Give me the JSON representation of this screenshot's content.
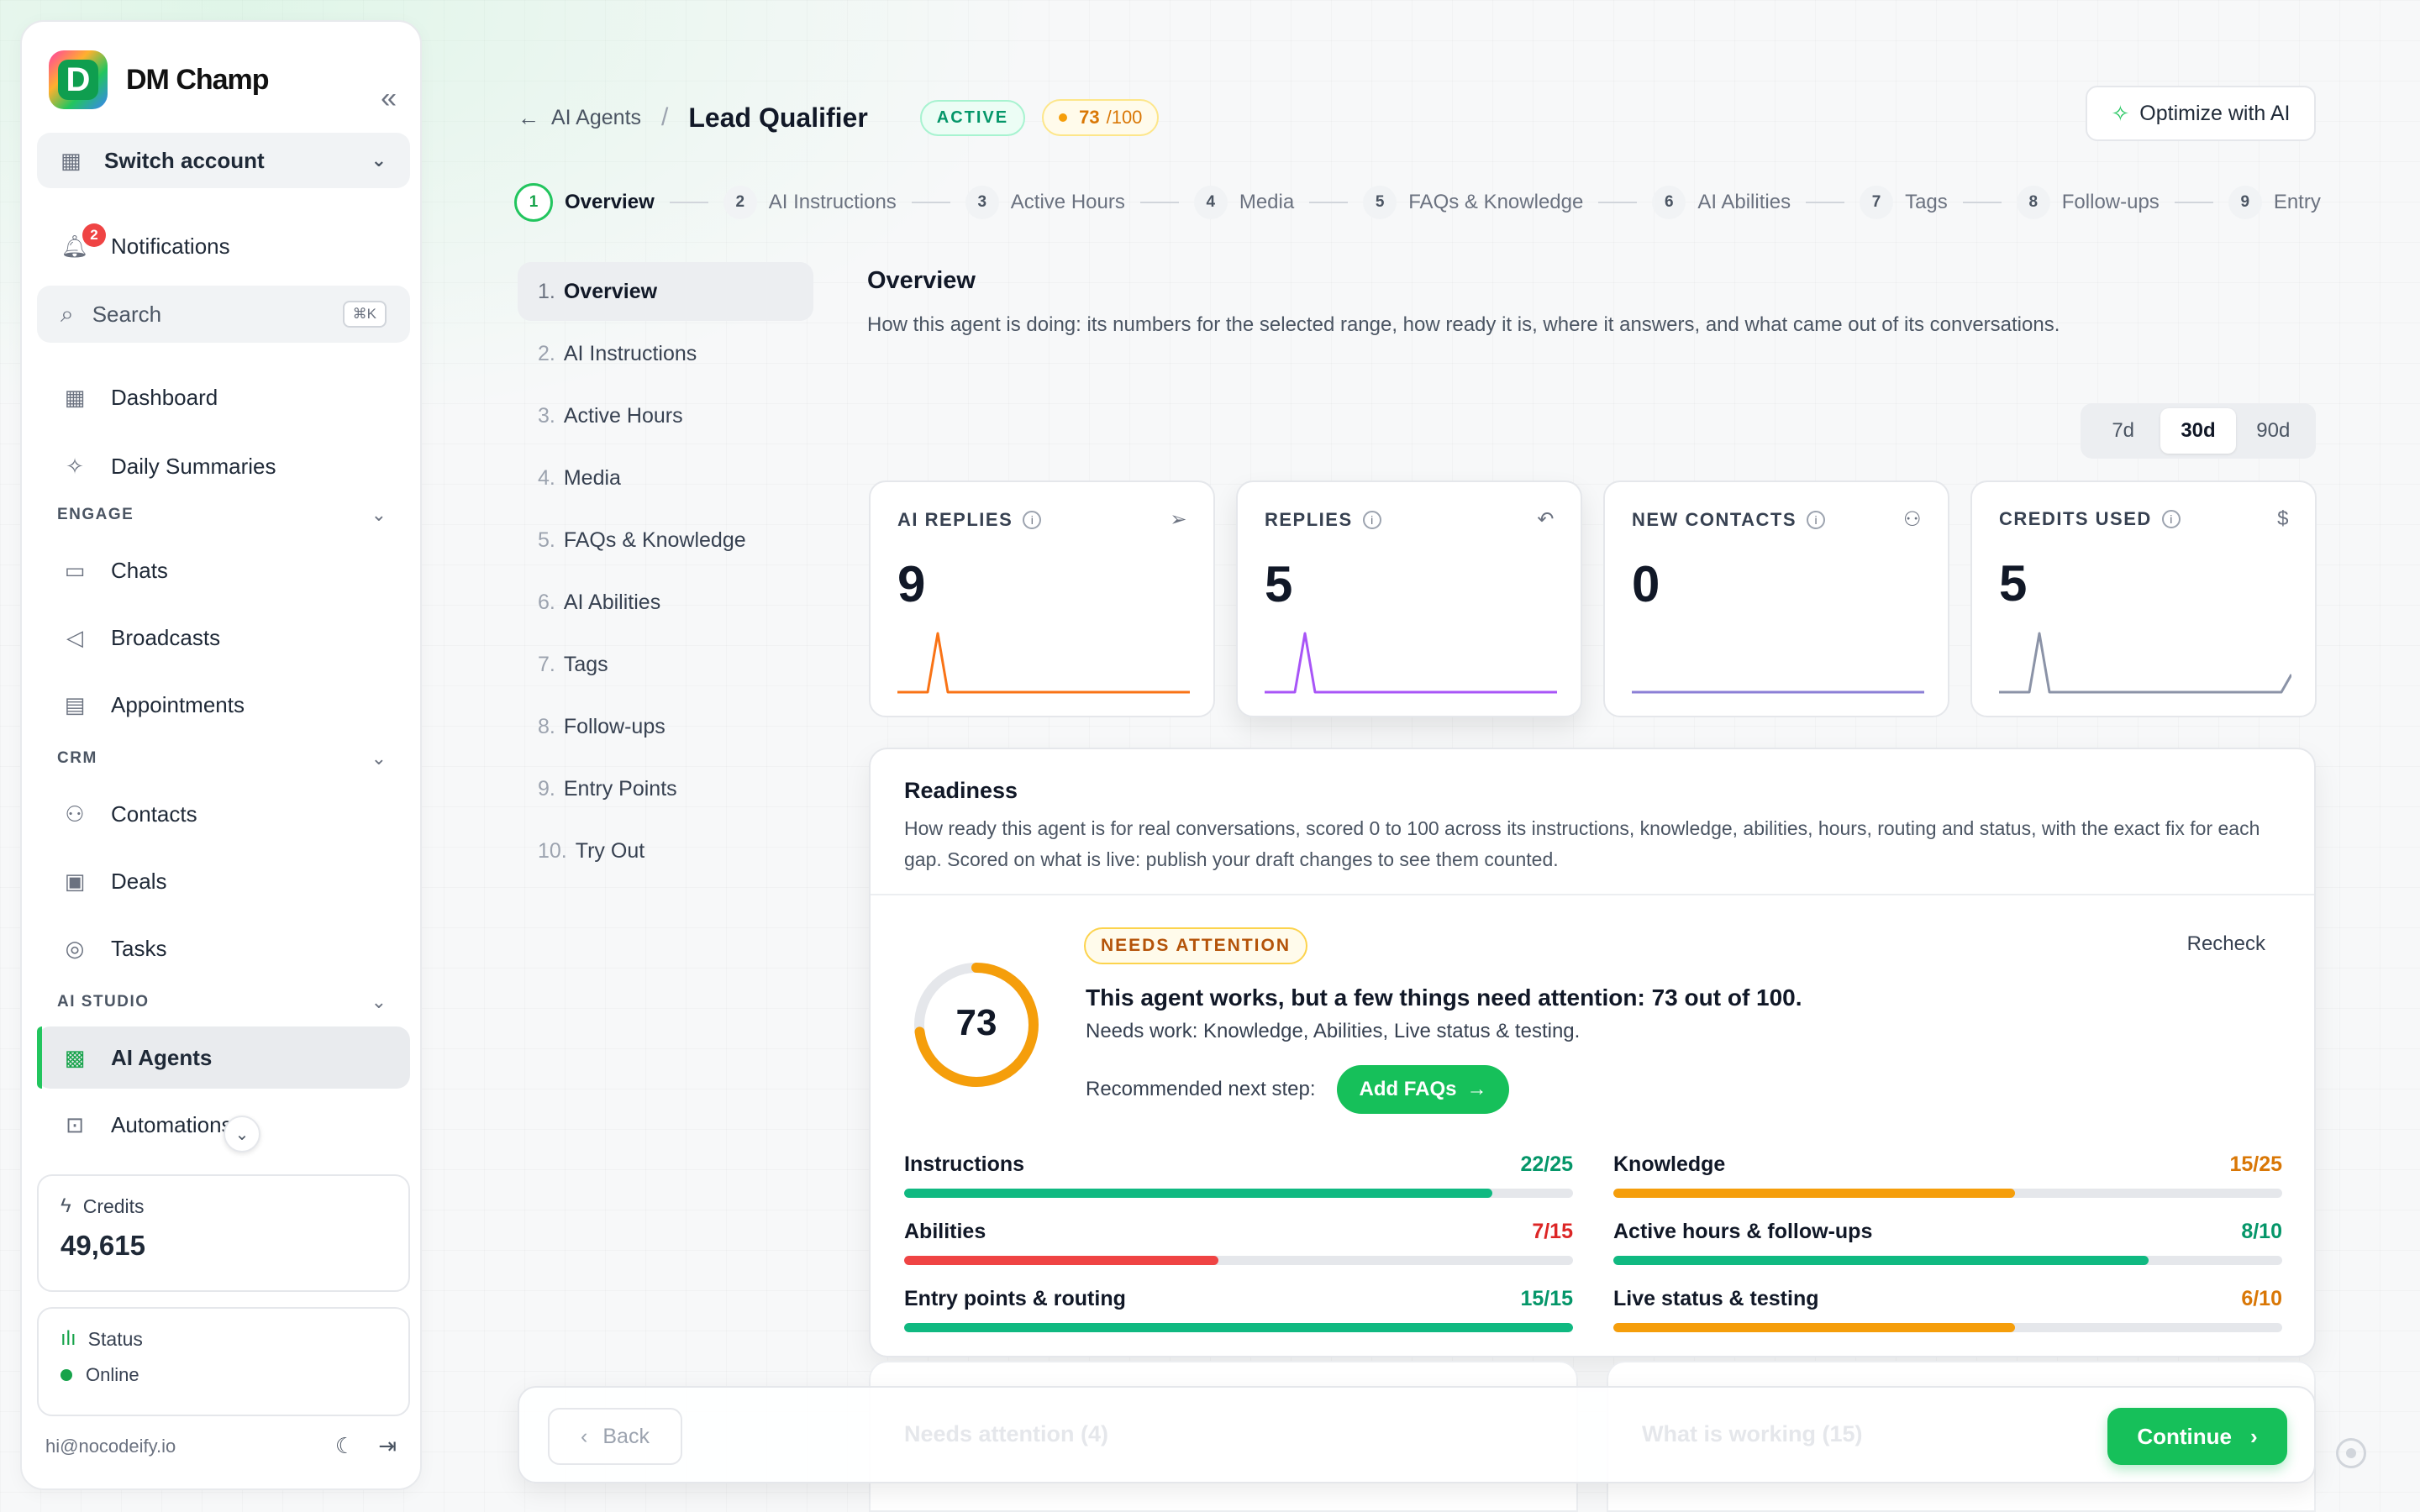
{
  "brand": {
    "name": "DM Champ",
    "logo_letter": "D"
  },
  "sidebar": {
    "switch_account": "Switch account",
    "notifications": {
      "label": "Notifications",
      "count": "2"
    },
    "search": {
      "placeholder": "Search",
      "shortcut": "⌘K"
    },
    "top_items": [
      {
        "label": "Dashboard",
        "icon": "grid-icon"
      },
      {
        "label": "Daily Summaries",
        "icon": "sparkles-icon"
      }
    ],
    "sections": [
      {
        "label": "ENGAGE",
        "items": [
          {
            "label": "Chats",
            "icon": "chat-icon"
          },
          {
            "label": "Broadcasts",
            "icon": "megaphone-icon"
          },
          {
            "label": "Appointments",
            "icon": "calendar-icon"
          }
        ]
      },
      {
        "label": "CRM",
        "items": [
          {
            "label": "Contacts",
            "icon": "users-icon"
          },
          {
            "label": "Deals",
            "icon": "briefcase-icon"
          },
          {
            "label": "Tasks",
            "icon": "check-circle-icon"
          }
        ]
      },
      {
        "label": "AI STUDIO",
        "items": [
          {
            "label": "AI Agents",
            "icon": "chip-icon",
            "active": true
          },
          {
            "label": "Automations",
            "icon": "robot-icon"
          }
        ]
      }
    ],
    "credits": {
      "label": "Credits",
      "value": "49,615"
    },
    "status": {
      "label": "Status",
      "value": "Online",
      "color": "#16a34a"
    },
    "footer": {
      "email": "hi@nocodeify.io"
    }
  },
  "header": {
    "breadcrumb_parent": "AI Agents",
    "title": "Lead Qualifier",
    "status_badge": "ACTIVE",
    "score": "73",
    "score_max": "/100",
    "optimize_label": "Optimize with AI"
  },
  "stepper": [
    {
      "num": "1",
      "label": "Overview",
      "current": true
    },
    {
      "num": "2",
      "label": "AI Instructions"
    },
    {
      "num": "3",
      "label": "Active Hours"
    },
    {
      "num": "4",
      "label": "Media"
    },
    {
      "num": "5",
      "label": "FAQs & Knowledge"
    },
    {
      "num": "6",
      "label": "AI Abilities"
    },
    {
      "num": "7",
      "label": "Tags"
    },
    {
      "num": "8",
      "label": "Follow-ups"
    },
    {
      "num": "9",
      "label": "Entry Points"
    }
  ],
  "step_list": [
    {
      "n": "1.",
      "label": "Overview",
      "active": true
    },
    {
      "n": "2.",
      "label": "AI Instructions"
    },
    {
      "n": "3.",
      "label": "Active Hours"
    },
    {
      "n": "4.",
      "label": "Media"
    },
    {
      "n": "5.",
      "label": "FAQs & Knowledge"
    },
    {
      "n": "6.",
      "label": "AI Abilities"
    },
    {
      "n": "7.",
      "label": "Tags"
    },
    {
      "n": "8.",
      "label": "Follow-ups"
    },
    {
      "n": "9.",
      "label": "Entry Points"
    },
    {
      "n": "10.",
      "label": "Try Out"
    }
  ],
  "overview": {
    "title": "Overview",
    "description": "How this agent is doing: its numbers for the selected range, how ready it is, where it answers, and what came out of its conversations.",
    "ranges": [
      "7d",
      "30d",
      "90d"
    ],
    "selected_range": "30d"
  },
  "metrics": [
    {
      "label": "AI REPLIES",
      "value": "9",
      "icon": "send-icon",
      "color": "#f97316",
      "spark": [
        0,
        0,
        0,
        0,
        1,
        0,
        0,
        0,
        0,
        0,
        0,
        0,
        0,
        0,
        0,
        0,
        0,
        0,
        0,
        0,
        0,
        0,
        0,
        0,
        0,
        0,
        0,
        0,
        0,
        0
      ],
      "elevated": false
    },
    {
      "label": "REPLIES",
      "value": "5",
      "icon": "reply-icon",
      "color": "#a855f7",
      "spark": [
        0,
        0,
        0,
        0,
        1,
        0,
        0,
        0,
        0,
        0,
        0,
        0,
        0,
        0,
        0,
        0,
        0,
        0,
        0,
        0,
        0,
        0,
        0,
        0,
        0,
        0,
        0,
        0,
        0,
        0
      ],
      "elevated": true
    },
    {
      "label": "NEW CONTACTS",
      "value": "0",
      "icon": "users-icon",
      "color": "#8b7fd6",
      "spark": [
        0,
        0,
        0,
        0,
        0,
        0,
        0,
        0,
        0,
        0,
        0,
        0,
        0,
        0,
        0,
        0,
        0,
        0,
        0,
        0,
        0,
        0,
        0,
        0,
        0,
        0,
        0,
        0,
        0,
        0
      ],
      "elevated": false
    },
    {
      "label": "CREDITS USED",
      "value": "5",
      "icon": "dollar-icon",
      "color": "#8b93a7",
      "spark": [
        0,
        0,
        0,
        0,
        1,
        0,
        0,
        0,
        0,
        0,
        0,
        0,
        0,
        0,
        0,
        0,
        0,
        0,
        0,
        0,
        0,
        0,
        0,
        0,
        0,
        0,
        0,
        0,
        0,
        0.3
      ],
      "elevated": false
    }
  ],
  "readiness": {
    "title": "Readiness",
    "description": "How ready this agent is for real conversations, scored 0 to 100 across its instructions, knowledge, abilities, hours, routing and status, with the exact fix for each gap. Scored on what is live: publish your draft changes to see them counted.",
    "badge": "NEEDS ATTENTION",
    "recheck": "Recheck",
    "score": "73",
    "score_fraction": 0.73,
    "headline": "This agent works, but a few things need attention: 73 out of 100.",
    "needs_work": "Needs work: Knowledge, Abilities, Live status & testing.",
    "next_step_label": "Recommended next step:",
    "next_step_button": "Add FAQs",
    "rows": [
      {
        "label": "Instructions",
        "score": "22/25",
        "fraction": 0.88,
        "color": "#10b981"
      },
      {
        "label": "Knowledge",
        "score": "15/25",
        "fraction": 0.6,
        "color": "#f59e0b"
      },
      {
        "label": "Abilities",
        "score": "7/15",
        "fraction": 0.47,
        "color": "#ef4444"
      },
      {
        "label": "Active hours & follow-ups",
        "score": "8/10",
        "fraction": 0.8,
        "color": "#10b981"
      },
      {
        "label": "Entry points & routing",
        "score": "15/15",
        "fraction": 1.0,
        "color": "#10b981"
      },
      {
        "label": "Live status & testing",
        "score": "6/10",
        "fraction": 0.6,
        "color": "#f59e0b"
      }
    ]
  },
  "footer_bar": {
    "back": "Back",
    "needs_attention": "Needs attention (4)",
    "working": "What is working (15)",
    "continue": "Continue"
  }
}
